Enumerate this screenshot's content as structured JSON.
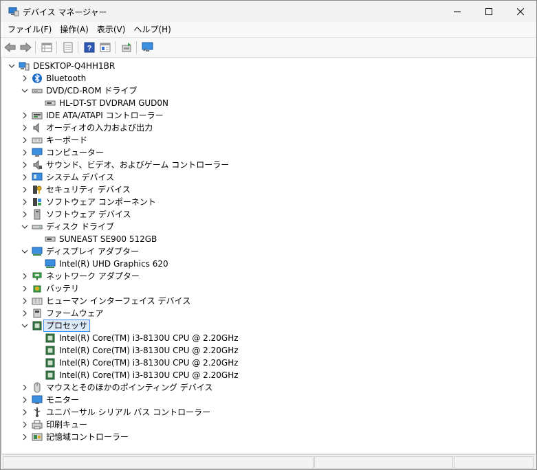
{
  "window": {
    "title": "デバイス マネージャー",
    "controls": {
      "minimize": "minimize",
      "maximize": "maximize",
      "close": "close"
    }
  },
  "menu": [
    "ファイル(F)",
    "操作(A)",
    "表示(V)",
    "ヘルプ(H)"
  ],
  "toolbar": [
    "back-arrow-icon",
    "forward-arrow-icon",
    "properties-grid-icon",
    "document-icon",
    "help-icon",
    "view-grid-icon",
    "update-driver-icon",
    "monitor-scan-icon"
  ],
  "tree": {
    "root": "DESKTOP-Q4HH1BR",
    "categories": [
      {
        "label": "Bluetooth",
        "icon": "bluetooth-icon",
        "expanded": false,
        "children": []
      },
      {
        "label": "DVD/CD-ROM ドライブ",
        "icon": "dvd-drive-icon",
        "expanded": true,
        "children": [
          "HL-DT-ST DVDRAM GUD0N"
        ]
      },
      {
        "label": "IDE ATA/ATAPI コントローラー",
        "icon": "ide-controller-icon",
        "expanded": false,
        "children": []
      },
      {
        "label": "オーディオの入力および出力",
        "icon": "speaker-icon",
        "expanded": false,
        "children": []
      },
      {
        "label": "キーボード",
        "icon": "keyboard-icon",
        "expanded": false,
        "children": []
      },
      {
        "label": "コンピューター",
        "icon": "computer-icon",
        "expanded": false,
        "children": []
      },
      {
        "label": "サウンド、ビデオ、およびゲーム コントローラー",
        "icon": "sound-icon",
        "expanded": false,
        "children": []
      },
      {
        "label": "システム デバイス",
        "icon": "system-device-icon",
        "expanded": false,
        "children": []
      },
      {
        "label": "セキュリティ デバイス",
        "icon": "security-key-icon",
        "expanded": false,
        "children": []
      },
      {
        "label": "ソフトウェア コンポーネント",
        "icon": "software-component-icon",
        "expanded": false,
        "children": []
      },
      {
        "label": "ソフトウェア デバイス",
        "icon": "software-device-icon",
        "expanded": false,
        "children": []
      },
      {
        "label": "ディスク ドライブ",
        "icon": "disk-drive-icon",
        "expanded": true,
        "children": [
          "SUNEAST SE900 512GB"
        ]
      },
      {
        "label": "ディスプレイ アダプター",
        "icon": "display-adapter-icon",
        "expanded": true,
        "children": [
          "Intel(R) UHD Graphics 620"
        ]
      },
      {
        "label": "ネットワーク アダプター",
        "icon": "network-adapter-icon",
        "expanded": false,
        "children": []
      },
      {
        "label": "バッテリ",
        "icon": "battery-icon",
        "expanded": false,
        "children": []
      },
      {
        "label": "ヒューマン インターフェイス デバイス",
        "icon": "hid-icon",
        "expanded": false,
        "children": []
      },
      {
        "label": "ファームウェア",
        "icon": "firmware-icon",
        "expanded": false,
        "children": []
      },
      {
        "label": "プロセッサ",
        "icon": "processor-icon",
        "expanded": true,
        "selected": true,
        "children": [
          "Intel(R) Core(TM) i3-8130U CPU @ 2.20GHz",
          "Intel(R) Core(TM) i3-8130U CPU @ 2.20GHz",
          "Intel(R) Core(TM) i3-8130U CPU @ 2.20GHz",
          "Intel(R) Core(TM) i3-8130U CPU @ 2.20GHz"
        ]
      },
      {
        "label": "マウスとそのほかのポインティング デバイス",
        "icon": "mouse-icon",
        "expanded": false,
        "children": []
      },
      {
        "label": "モニター",
        "icon": "monitor-icon",
        "expanded": false,
        "children": []
      },
      {
        "label": "ユニバーサル シリアル バス コントローラー",
        "icon": "usb-icon",
        "expanded": false,
        "children": []
      },
      {
        "label": "印刷キュー",
        "icon": "printer-icon",
        "expanded": false,
        "children": []
      },
      {
        "label": "記憶域コントローラー",
        "icon": "storage-controller-icon",
        "expanded": false,
        "children": []
      }
    ]
  },
  "colors": {
    "selection_bg": "#dbe9f9",
    "selection_border": "#3e8ee8",
    "accent": "#1b6ac9"
  }
}
